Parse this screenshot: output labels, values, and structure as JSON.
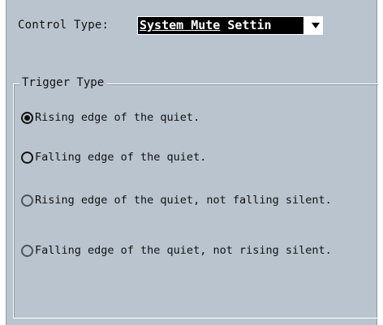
{
  "control_type": {
    "label": "Control Type:",
    "selected_value_part1": "System Mute",
    "selected_value_part2": " Settin"
  },
  "trigger_type": {
    "title": "Trigger Type",
    "options": [
      {
        "label": "Rising edge of the quiet.",
        "checked": true
      },
      {
        "label": "Falling edge of the quiet.",
        "checked": false
      },
      {
        "label": "Rising edge of the quiet, not falling silent.",
        "checked": false
      },
      {
        "label": "Falling edge of the quiet, not rising silent.",
        "checked": false
      }
    ]
  },
  "colors": {
    "panel_bg": "#b9c4cf",
    "selection_bg": "#000000",
    "selection_fg": "#ffffff"
  }
}
